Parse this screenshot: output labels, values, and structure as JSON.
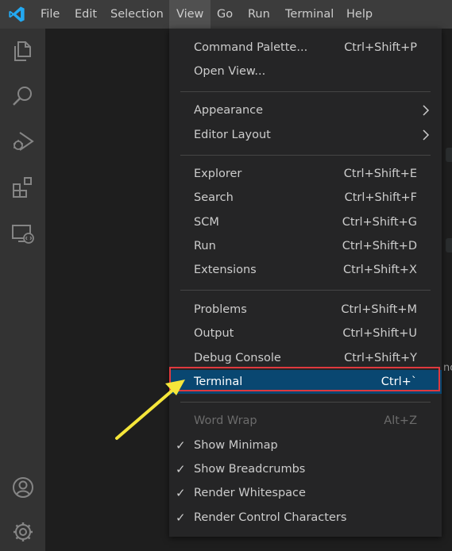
{
  "menubar": {
    "items": [
      "File",
      "Edit",
      "Selection",
      "View",
      "Go",
      "Run",
      "Terminal",
      "Help"
    ],
    "active": "View"
  },
  "activity_bar": {
    "icons": [
      "explorer-icon",
      "search-icon",
      "run-debug-icon",
      "extensions-icon",
      "remote-explorer-icon",
      "account-icon",
      "manage-gear-icon"
    ]
  },
  "view_menu": {
    "command_palette": {
      "label": "Command Palette...",
      "shortcut": "Ctrl+Shift+P"
    },
    "open_view": {
      "label": "Open View..."
    },
    "appearance": {
      "label": "Appearance"
    },
    "editor_layout": {
      "label": "Editor Layout"
    },
    "explorer": {
      "label": "Explorer",
      "shortcut": "Ctrl+Shift+E"
    },
    "search": {
      "label": "Search",
      "shortcut": "Ctrl+Shift+F"
    },
    "scm": {
      "label": "SCM",
      "shortcut": "Ctrl+Shift+G"
    },
    "run": {
      "label": "Run",
      "shortcut": "Ctrl+Shift+D"
    },
    "extensions": {
      "label": "Extensions",
      "shortcut": "Ctrl+Shift+X"
    },
    "problems": {
      "label": "Problems",
      "shortcut": "Ctrl+Shift+M"
    },
    "output": {
      "label": "Output",
      "shortcut": "Ctrl+Shift+U"
    },
    "debug_console": {
      "label": "Debug Console",
      "shortcut": "Ctrl+Shift+Y"
    },
    "terminal": {
      "label": "Terminal",
      "shortcut": "Ctrl+`"
    },
    "word_wrap": {
      "label": "Word Wrap",
      "shortcut": "Alt+Z"
    },
    "show_minimap": {
      "label": "Show Minimap",
      "checked": true
    },
    "show_breadcrumbs": {
      "label": "Show Breadcrumbs",
      "checked": true
    },
    "render_whitespace": {
      "label": "Render Whitespace",
      "checked": true
    },
    "render_control_characters": {
      "label": "Render Control Characters",
      "checked": true
    }
  },
  "check_glyph": "✓",
  "editor_edge_text": "nc",
  "colors": {
    "highlight": "#094771",
    "annotation_box": "#e0393e",
    "annotation_arrow": "#f5e63a",
    "logo": "#23a9f2"
  }
}
